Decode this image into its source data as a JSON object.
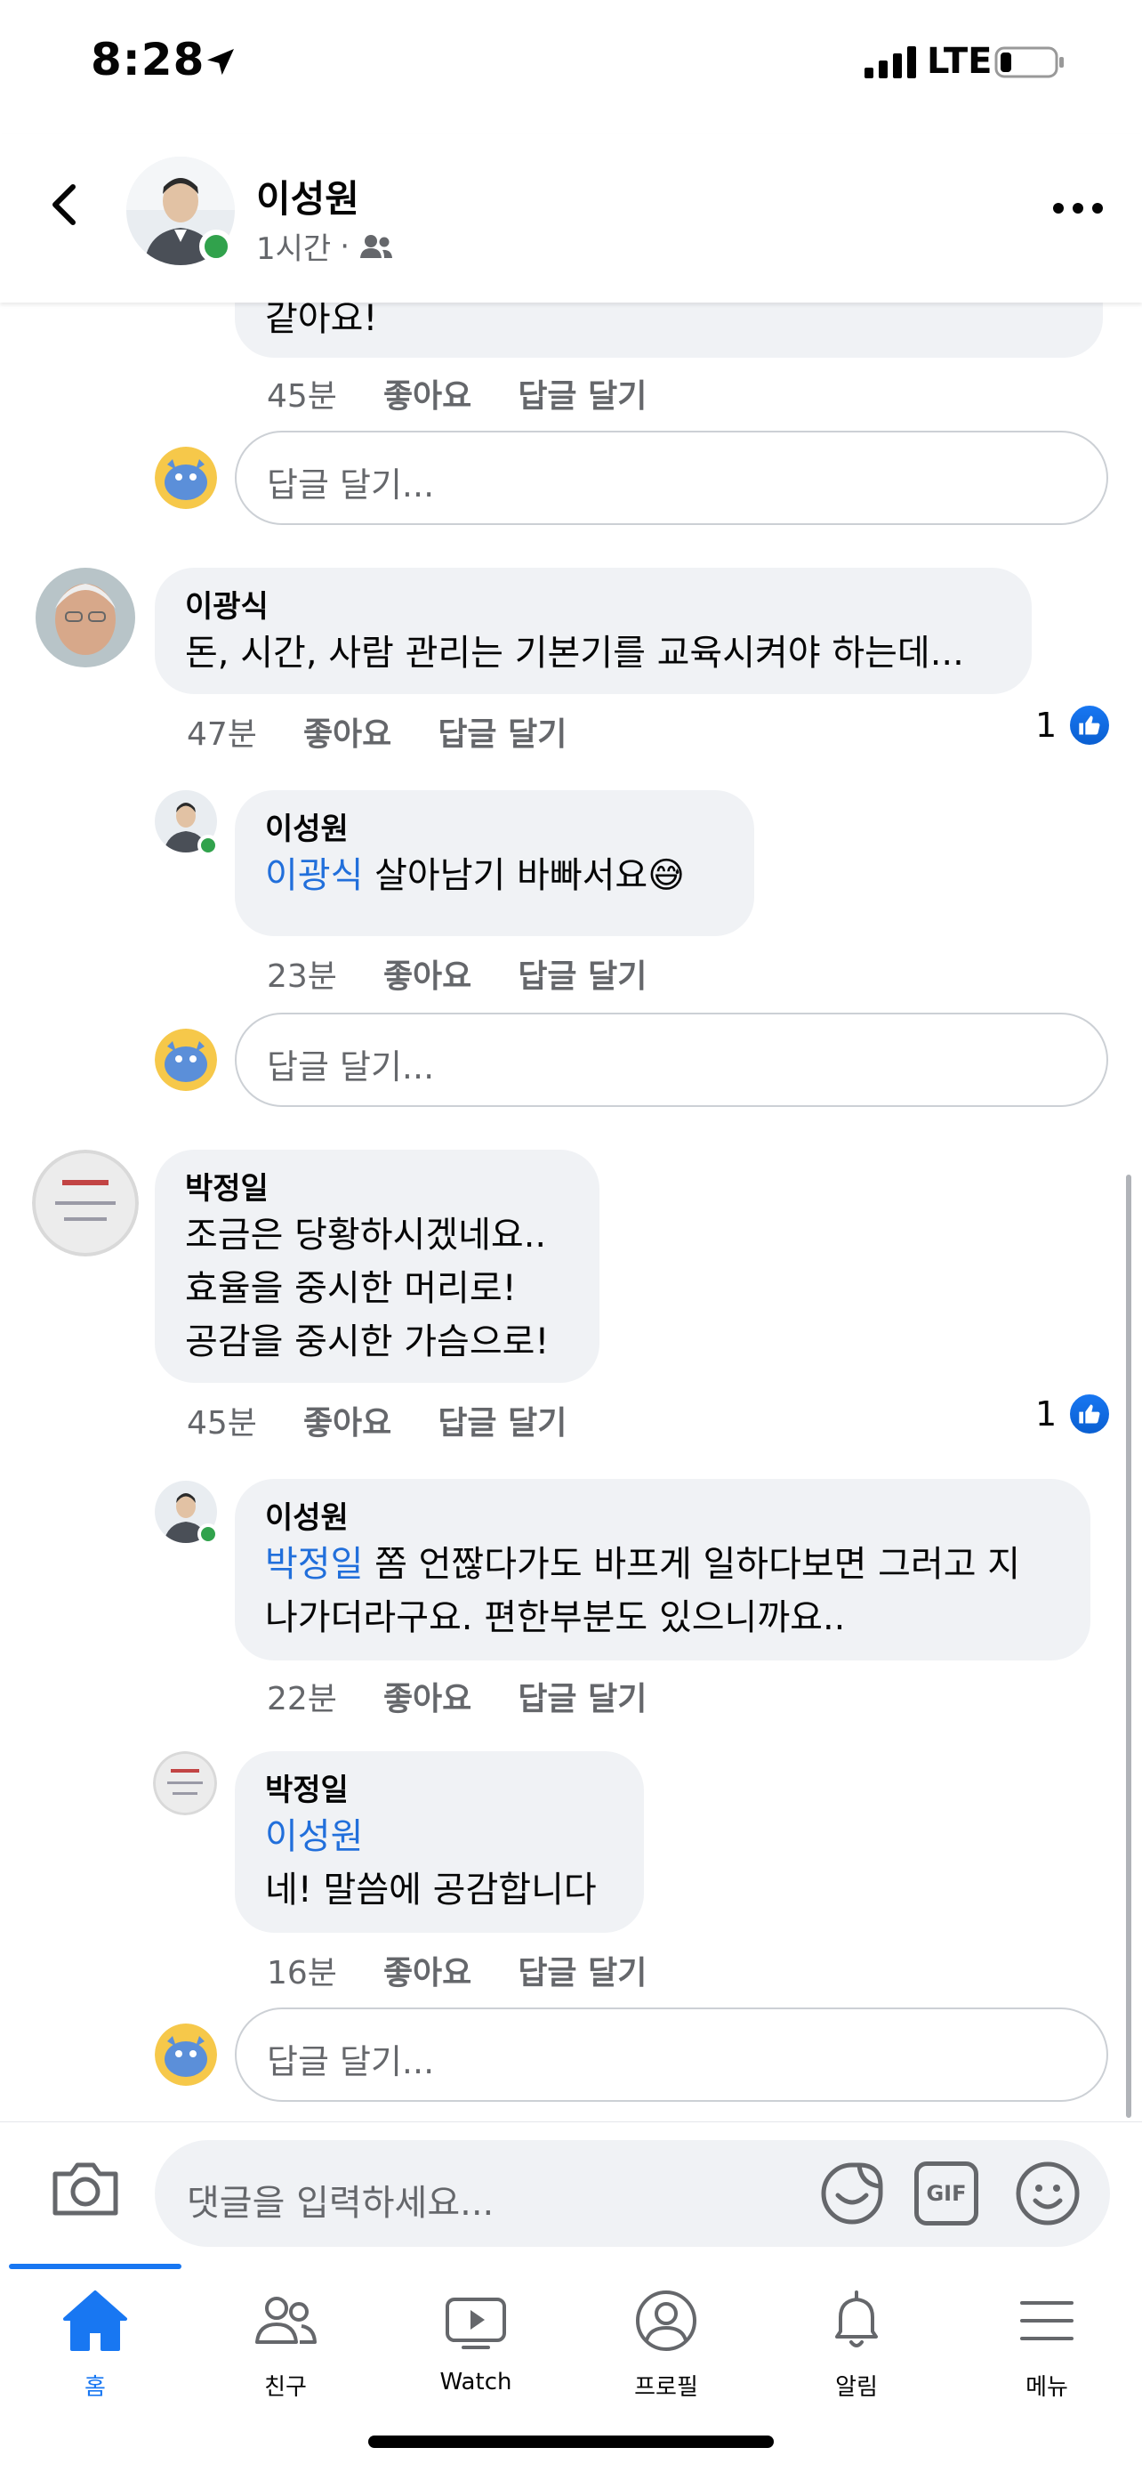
{
  "status_bar": {
    "time": "8:28",
    "network": "LTE"
  },
  "header": {
    "name": "이성원",
    "time": "1시간",
    "separator": "·",
    "audience_icon": "friends-icon"
  },
  "comments": {
    "c0": {
      "text": "같아요!",
      "time": "45분",
      "like": "좋아요",
      "reply": "답글 달기"
    },
    "reply_box_1": {
      "placeholder": "답글 달기..."
    },
    "c1": {
      "author": "이광식",
      "text": "돈, 시간, 사람 관리는 기본기를 교육시켜야 하는데...",
      "time": "47분",
      "like": "좋아요",
      "reply": "답글 달기",
      "likes": "1"
    },
    "c1_r1": {
      "author": "이성원",
      "mention": "이광식",
      "text": " 살아남기 바빠서요",
      "emoji": "😅",
      "time": "23분",
      "like": "좋아요",
      "reply": "답글 달기"
    },
    "reply_box_2": {
      "placeholder": "답글 달기..."
    },
    "c2": {
      "author": "박정일",
      "line1": "조금은 당황하시겠네요..",
      "line2": "효율을 중시한 머리로!",
      "line3": "공감을 중시한 가슴으로!",
      "time": "45분",
      "like": "좋아요",
      "reply": "답글 달기",
      "likes": "1"
    },
    "c2_r1": {
      "author": "이성원",
      "mention": "박정일",
      "text_line1": " 쫌 언짢다가도 바프게 일하다보면 그러고 지",
      "text_line2": "나가더라구요. 편한부분도 있으니까요..",
      "time": "22분",
      "like": "좋아요",
      "reply": "답글 달기"
    },
    "c2_r2": {
      "author": "박정일",
      "mention": "이성원",
      "text": "네! 말씀에 공감합니다",
      "time": "16분",
      "like": "좋아요",
      "reply": "답글 달기"
    },
    "reply_box_3": {
      "placeholder": "답글 달기..."
    }
  },
  "composer": {
    "placeholder": "댓글을 입력하세요...",
    "gif_label": "GIF"
  },
  "tabs": [
    {
      "label": "홈",
      "icon": "home-icon",
      "active": true
    },
    {
      "label": "친구",
      "icon": "friends-icon"
    },
    {
      "label": "Watch",
      "icon": "watch-icon"
    },
    {
      "label": "프로필",
      "icon": "profile-icon"
    },
    {
      "label": "알림",
      "icon": "bell-icon"
    },
    {
      "label": "메뉴",
      "icon": "menu-icon"
    }
  ],
  "colors": {
    "accent": "#1877f2",
    "mention": "#216fdb",
    "bubble": "#f0f2f5",
    "online": "#31a24c"
  }
}
